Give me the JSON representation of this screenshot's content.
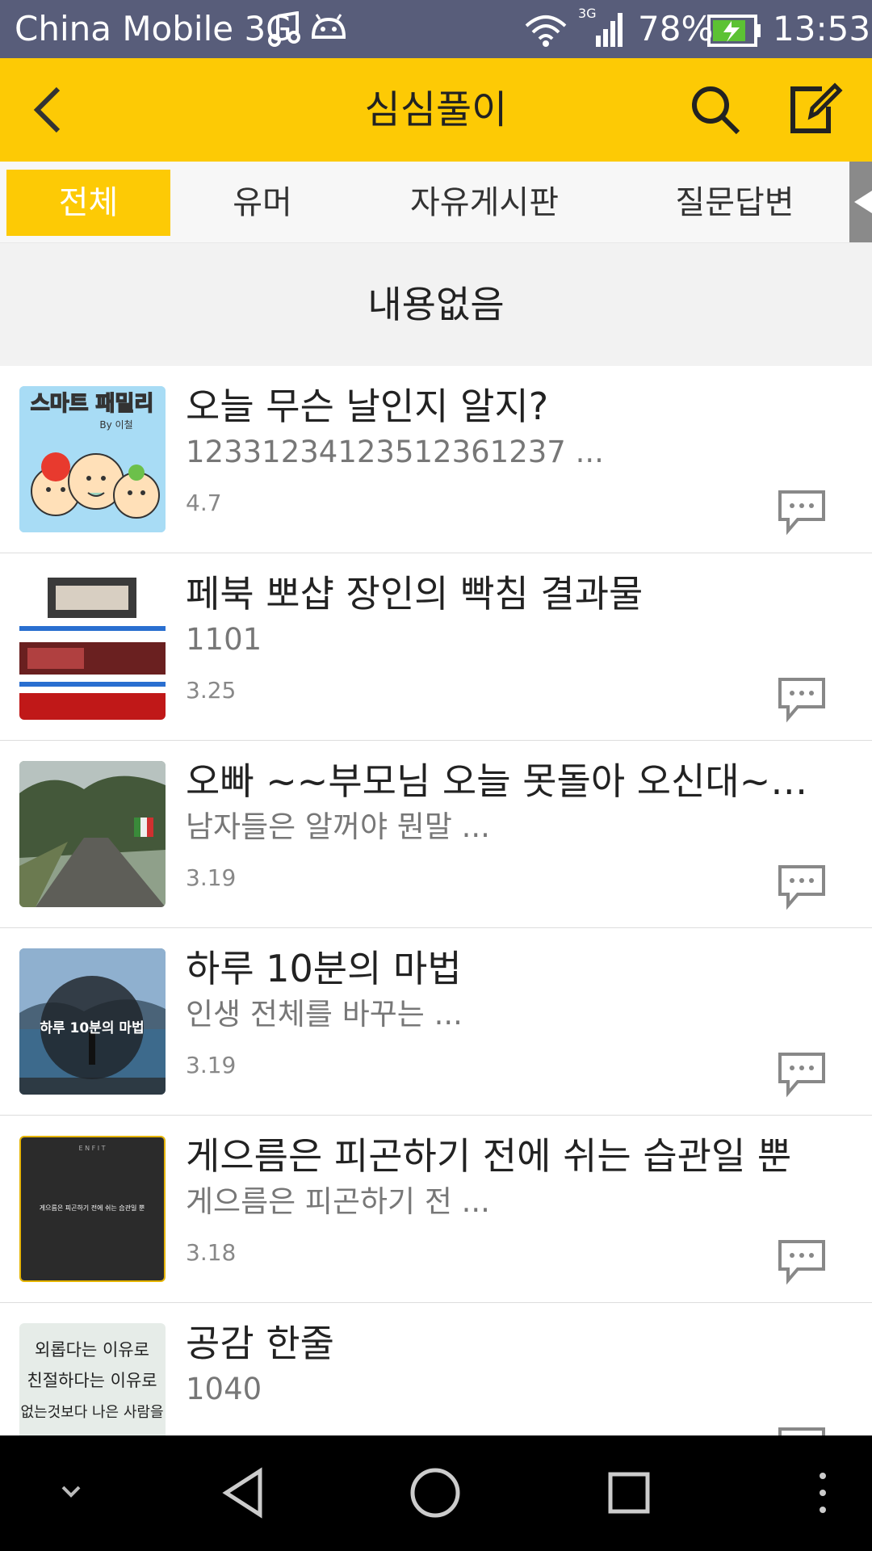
{
  "statusbar": {
    "carrier": "China Mobile 3G",
    "network": "3G",
    "battery": "78%",
    "time": "13:53"
  },
  "appbar": {
    "title": "심심풀이",
    "back_icon": "chevron-left-icon",
    "search_icon": "search-icon",
    "write_icon": "compose-icon",
    "accent": "#fdca05"
  },
  "tabs": [
    {
      "label": "전체",
      "active": true
    },
    {
      "label": "유머",
      "active": false
    },
    {
      "label": "자유게시판",
      "active": false
    },
    {
      "label": "질문답변",
      "active": false
    }
  ],
  "empty_notice": "내용없음",
  "posts": [
    {
      "title": "오늘 무슨 날인지 알지?",
      "subtitle": "12331234123512361237 ...",
      "meta": "4.7"
    },
    {
      "title": "페북 뽀샵 장인의 빡침 결과물",
      "subtitle": "1101",
      "meta": "3.25"
    },
    {
      "title": "오빠 ~~부모님 오늘 못돌아 오신대~~...",
      "subtitle": "남자들은 알꺼야 뭔말 ...",
      "meta": "3.19"
    },
    {
      "title": "하루 10분의 마법",
      "subtitle": "인생 전체를 바꾸는 ...",
      "meta": "3.19",
      "thumb_text": "하루 10분의 마법"
    },
    {
      "title": "게으름은 피곤하기 전에 쉬는 습관일 뿐",
      "subtitle": "게으름은 피곤하기 전 ...",
      "meta": "3.18"
    },
    {
      "title": "공감 한줄",
      "subtitle": "1040",
      "meta": ""
    }
  ],
  "thumb_texts": {
    "smart_family": "스마트 패밀리",
    "by": "By 이철",
    "enfit": "E N F I T",
    "laziness_caption": "게으름은 피곤하기 전에 쉬는 습관일 뿐",
    "handwriting": [
      "외롭다는 이유로",
      "친절하다는 이유로",
      "없는것보다 나은 사람을"
    ]
  },
  "navbar": {
    "icons": [
      "chevron-down-icon",
      "back-triangle-icon",
      "home-circle-icon",
      "recents-square-icon",
      "more-vertical-icon"
    ]
  }
}
